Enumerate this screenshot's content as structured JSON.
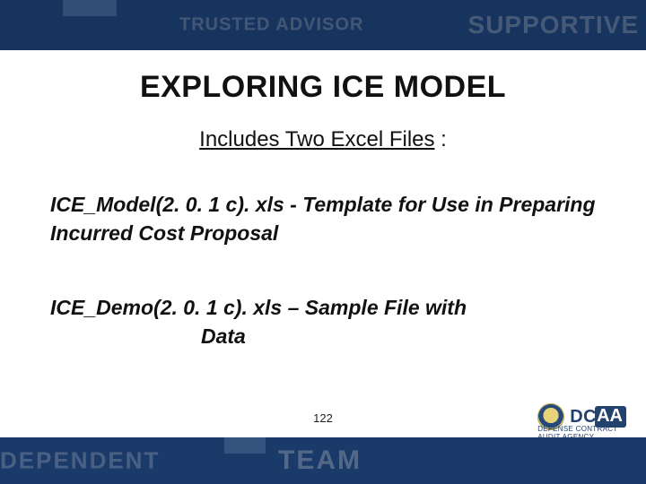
{
  "top_band": {
    "text1": "TRUSTED ADVISOR",
    "text2": "SUPPORTIVE"
  },
  "bottom_band": {
    "text1": "INDEPENDENT",
    "text2": "TEAM"
  },
  "title": "EXPLORING ICE MODEL",
  "subtitle_underlined": "Includes Two Excel Files",
  "subtitle_trailer": " :",
  "body1": "ICE_Model(2. 0. 1 c). xls  - Template for Use in Preparing Incurred Cost Proposal",
  "body2_line1": "ICE_Demo(2. 0. 1 c). xls – Sample File with",
  "body2_line2": "Data",
  "page_number": "122",
  "logo": {
    "primary": "DC",
    "pill": "AA",
    "sub": "DEFENSE CONTRACT AUDIT AGENCY"
  }
}
